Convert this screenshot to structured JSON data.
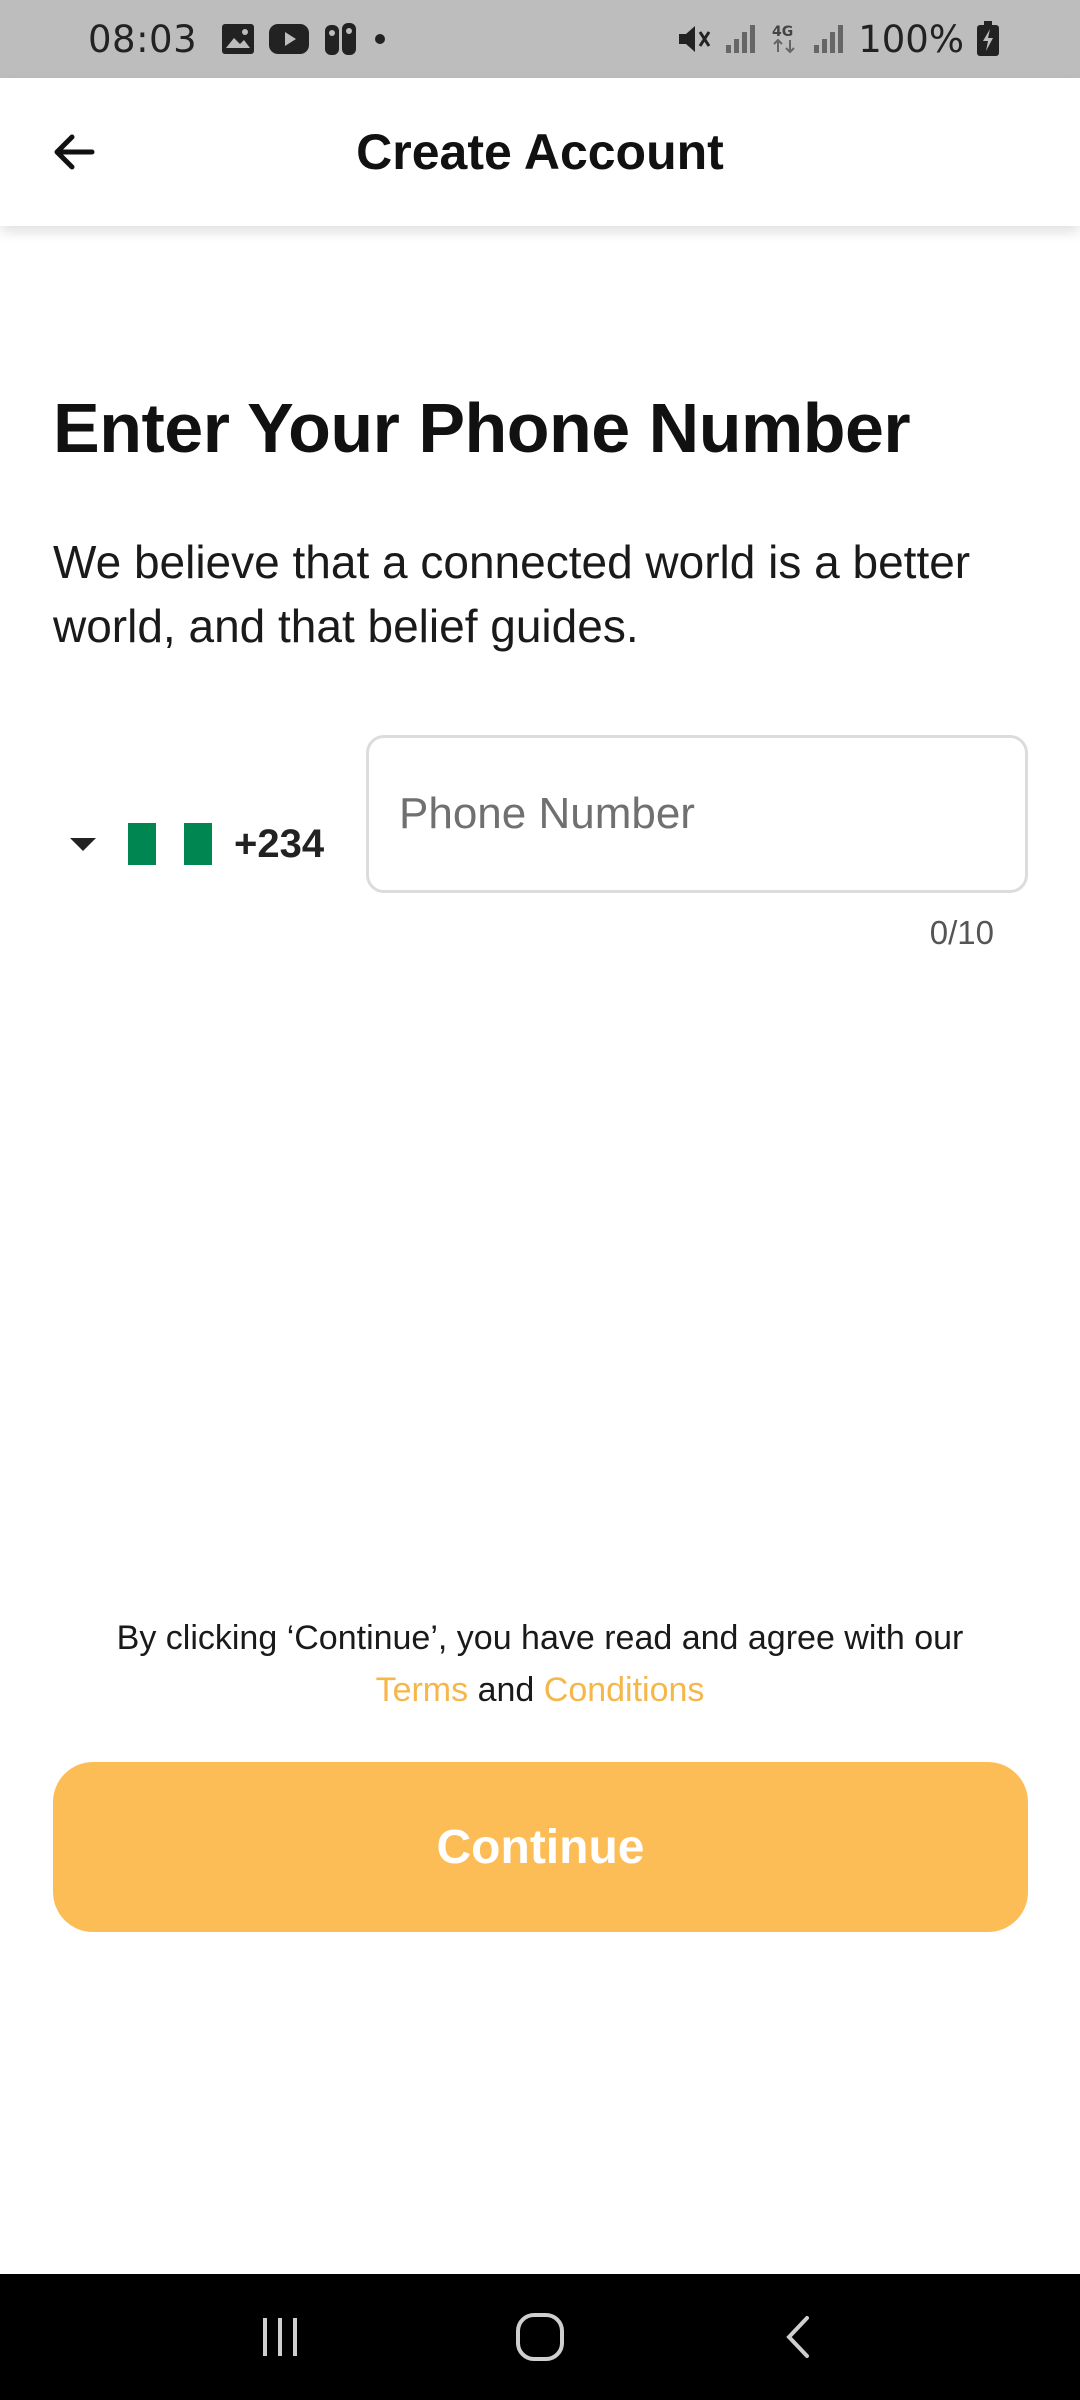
{
  "status_bar": {
    "time": "08:03",
    "battery_text": "100%",
    "left_icons": [
      "gallery-icon",
      "youtube-icon",
      "app-icon",
      "dot-icon"
    ],
    "right_icons": [
      "mute-icon",
      "signal-icon",
      "4g-icon",
      "signal-icon",
      "battery-charging-icon"
    ]
  },
  "app_bar": {
    "title": "Create Account",
    "back_icon": "arrow-left-icon"
  },
  "main": {
    "heading": "Enter Your Phone Number",
    "subtitle": "We believe that a connected world is a better world, and that belief guides.",
    "country": {
      "dial_code": "+234",
      "flag": "nigeria-flag"
    },
    "phone_input": {
      "placeholder": "Phone Number",
      "value": ""
    },
    "counter": "0/10",
    "terms": {
      "prefix": "By clicking ‘Continue’, you have read and agree with our",
      "terms_link": "Terms",
      "and": "and",
      "conditions_link": "Conditions"
    },
    "continue_label": "Continue"
  },
  "colors": {
    "accent": "#fdbd56",
    "link": "#f5b74a",
    "flag_green": "#008751"
  }
}
